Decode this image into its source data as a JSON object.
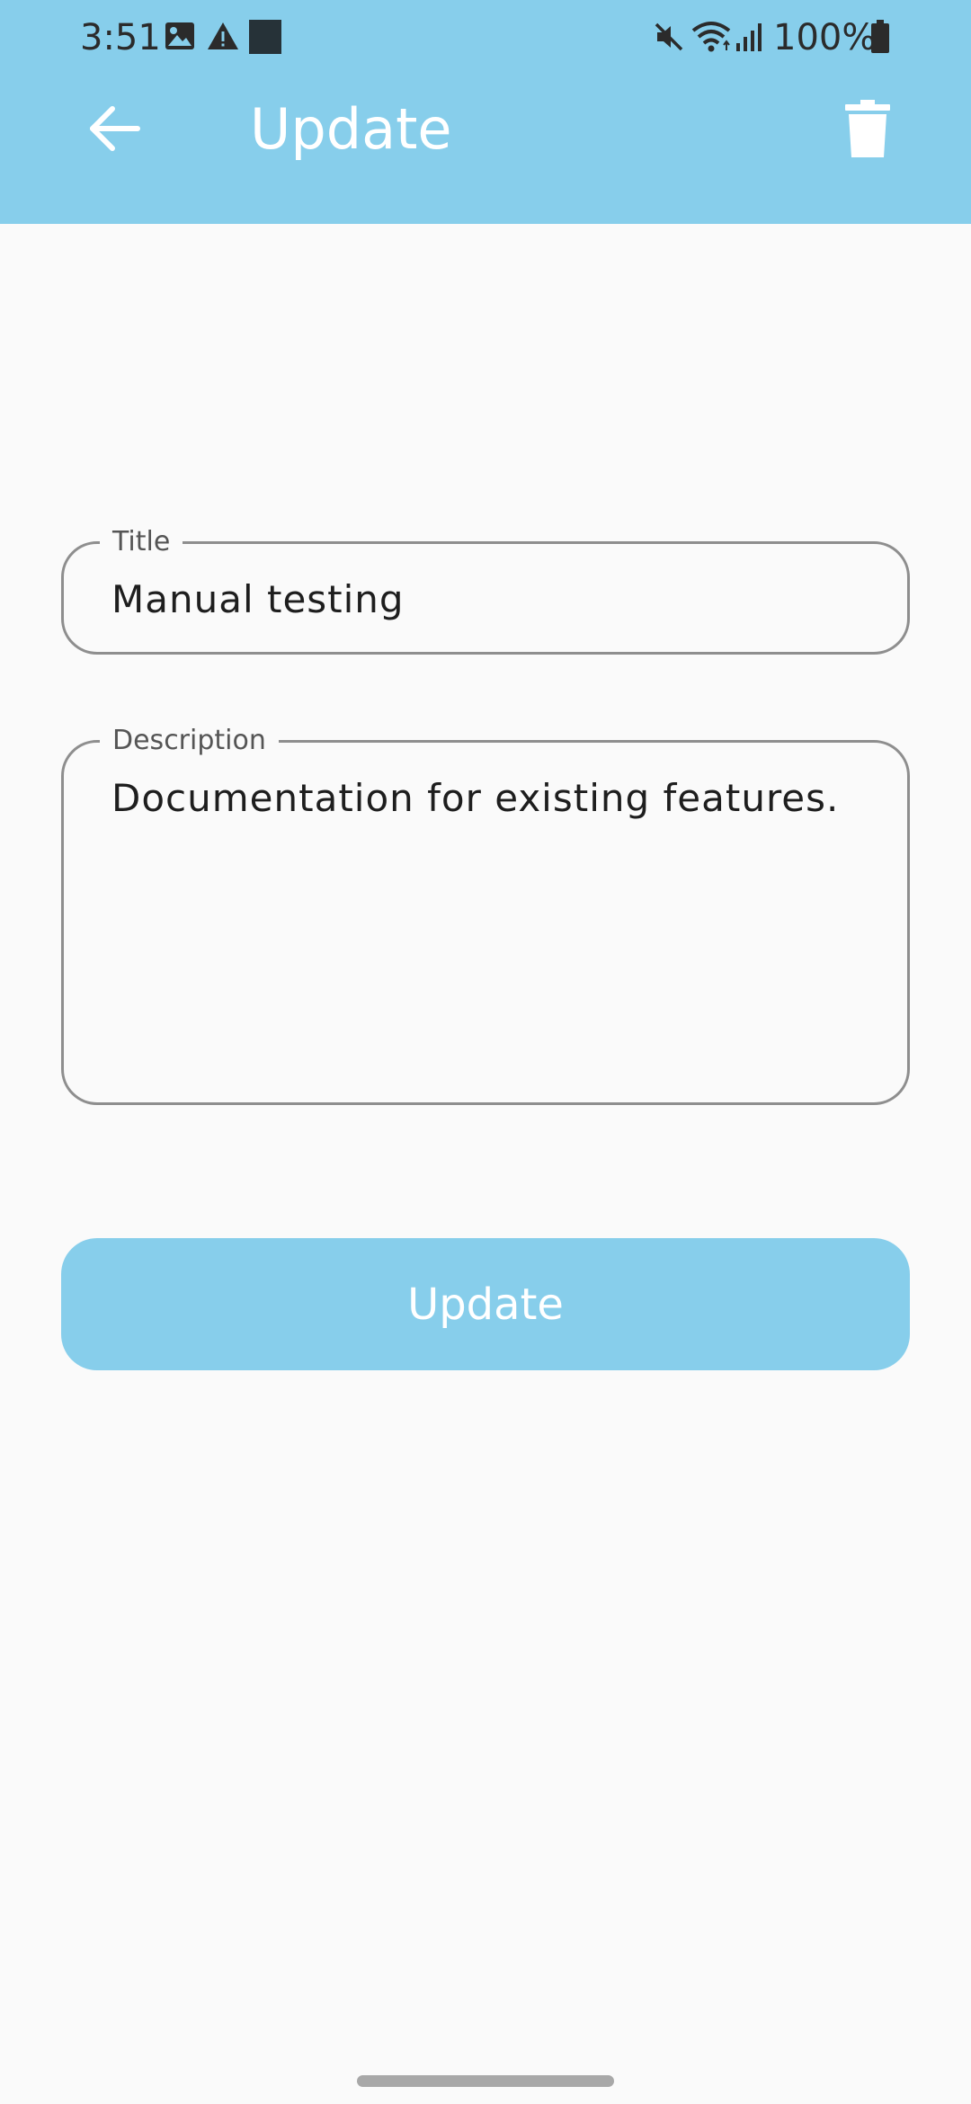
{
  "status_bar": {
    "time": "3:51",
    "battery": "100%",
    "icons": [
      "image-icon",
      "warning-icon",
      "square-icon",
      "mute-icon",
      "wifi-icon",
      "signal-icon",
      "battery-icon"
    ]
  },
  "app_bar": {
    "title": "Update",
    "back_icon": "arrow-left-icon",
    "delete_icon": "trash-icon",
    "background": "#87CEEB"
  },
  "form": {
    "title_field": {
      "label": "Title",
      "value": "Manual testing"
    },
    "description_field": {
      "label": "Description",
      "value": "Documentation for existing features."
    },
    "submit_label": "Update"
  },
  "colors": {
    "accent": "#87CEEB",
    "background": "#FAFAFA",
    "border": "#8E8E8E"
  }
}
